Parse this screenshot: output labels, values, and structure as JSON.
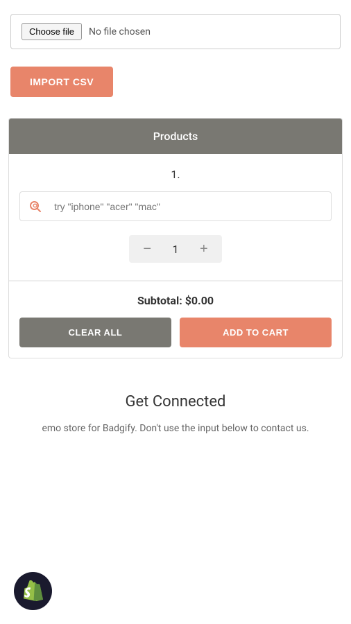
{
  "file_section": {
    "choose_file_label": "Choose file",
    "no_file_label": "No file chosen"
  },
  "import_button": {
    "label": "IMPORT CSV"
  },
  "products_section": {
    "header": "Products",
    "product_number": "1.",
    "search_placeholder": "try \"iphone\" \"acer\" \"mac\"",
    "quantity": "1",
    "subtotal_label": "Subtotal:",
    "subtotal_value": "$0.00",
    "clear_all_label": "CLEAR ALL",
    "add_to_cart_label": "ADD TO CART"
  },
  "get_connected": {
    "title": "Get Connected",
    "description": "emo store for Badgify. Don't use the input below to contact us."
  },
  "icons": {
    "search": "🔍",
    "minus": "−",
    "plus": "+"
  }
}
